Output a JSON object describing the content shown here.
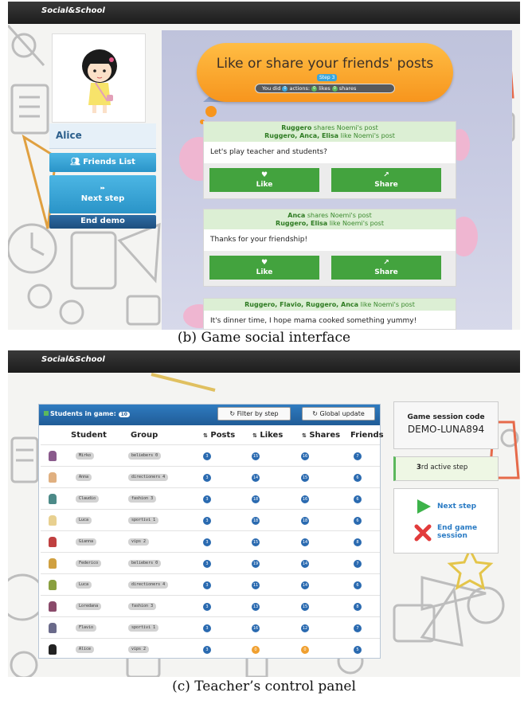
{
  "brand": "Social&School",
  "captions": {
    "b": "(b) Game social interface",
    "c": "(c) Teacher’s control panel"
  },
  "social": {
    "user_name": "Alice",
    "friends_list_label": "Friends List",
    "next_step_label": "Next step",
    "end_demo_label": "End demo",
    "banner_title": "Like or share your friends' posts",
    "step_tag": "Step 3",
    "actions_bar": {
      "prefix": "You did",
      "actions_count": "0",
      "actions_word": "actions:",
      "likes_count": "0",
      "likes_word": "likes",
      "shares_count": "0",
      "shares_word": "shares"
    },
    "like_label": "Like",
    "share_label": "Share",
    "posts": [
      {
        "sharer": "Ruggero",
        "sharer_rest": "shares Noemi's post",
        "likers": "Ruggero, Anca, Elisa",
        "likers_rest": "like Noemi's post",
        "text": "Let's play teacher and students?"
      },
      {
        "sharer": "Anca",
        "sharer_rest": "shares Noemi's post",
        "likers": "Ruggero, Elisa",
        "likers_rest": "like Noemi's post",
        "text": "Thanks for your friendship!"
      },
      {
        "sharer": "",
        "sharer_rest": "",
        "likers": "Ruggero, Flavio, Ruggero, Anca",
        "likers_rest": "like Noemi's post",
        "text": "It's dinner time, I hope mama cooked something yummy!"
      }
    ]
  },
  "teacher": {
    "students_in_game_label": "Students in game:",
    "students_count": "10",
    "filter_label": "Filter by step",
    "global_update_label": "Global update",
    "columns": {
      "student": "Student",
      "group": "Group",
      "posts": "Posts",
      "likes": "Likes",
      "shares": "Shares",
      "friends": "Friends"
    },
    "students": [
      {
        "name": "Mirko",
        "group": "beliebers 0",
        "posts": "3",
        "likes": "15",
        "shares": "16",
        "friends": "7",
        "avatar_color": "#8a5a8c"
      },
      {
        "name": "Anna",
        "group": "directioners 4",
        "posts": "3",
        "likes": "14",
        "shares": "15",
        "friends": "6",
        "avatar_color": "#e0b080"
      },
      {
        "name": "Claudio",
        "group": "fashion 3",
        "posts": "3",
        "likes": "18",
        "shares": "16",
        "friends": "6",
        "avatar_color": "#4c8a88"
      },
      {
        "name": "Luca",
        "group": "sportivi 1",
        "posts": "3",
        "likes": "18",
        "shares": "18",
        "friends": "6",
        "avatar_color": "#e8d090"
      },
      {
        "name": "Gianna",
        "group": "vips 2",
        "posts": "3",
        "likes": "15",
        "shares": "14",
        "friends": "8",
        "avatar_color": "#c04040"
      },
      {
        "name": "Federico",
        "group": "beliebers 0",
        "posts": "3",
        "likes": "19",
        "shares": "14",
        "friends": "7",
        "avatar_color": "#d0a040"
      },
      {
        "name": "Luca",
        "group": "directioners 4",
        "posts": "3",
        "likes": "11",
        "shares": "14",
        "friends": "6",
        "avatar_color": "#8aa040"
      },
      {
        "name": "Loredana",
        "group": "fashion 3",
        "posts": "3",
        "likes": "13",
        "shares": "15",
        "friends": "8",
        "avatar_color": "#8a4a6a"
      },
      {
        "name": "Flavio",
        "group": "sportivi 1",
        "posts": "3",
        "likes": "16",
        "shares": "12",
        "friends": "7",
        "avatar_color": "#6a6a8a"
      },
      {
        "name": "Alice",
        "group": "vips 2",
        "posts": "3",
        "likes": "0",
        "shares": "0",
        "friends": "5",
        "avatar_color": "#222222"
      }
    ],
    "session_code_label": "Game session code",
    "session_code": "DEMO-LUNA894",
    "active_step_num": "3",
    "active_step_text": "rd active step",
    "next_step_label": "Next step",
    "end_session_label": "End game\nsession"
  }
}
